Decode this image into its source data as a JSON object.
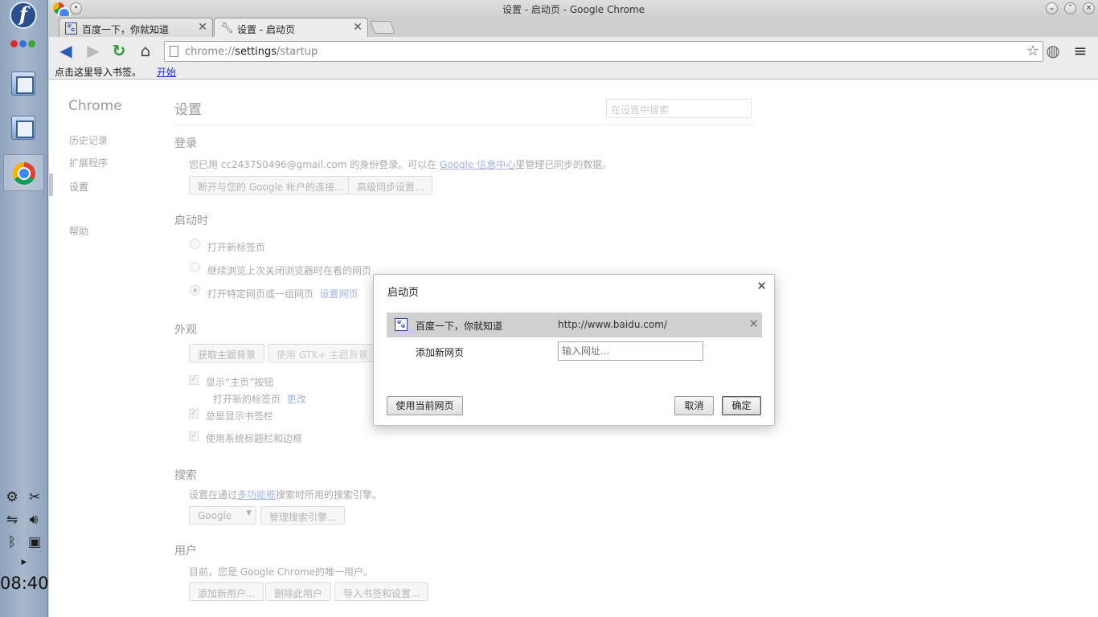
{
  "desktop": {
    "clock": "08:40",
    "fedora_letter": "f"
  },
  "window": {
    "title": "设置 - 启动页 - Google Chrome",
    "tabs": [
      {
        "title": "百度一下，你就知道",
        "icon": "baidu-paw-icon"
      },
      {
        "title": "设置 - 启动页",
        "icon": "wrench-icon"
      }
    ],
    "omnibox": {
      "scheme": "chrome://",
      "host": "settings",
      "path": "/startup"
    },
    "bookmark_bar": {
      "prompt": "点击这里导入书签。",
      "link": "开始"
    }
  },
  "sidebar": {
    "title": "Chrome",
    "items": [
      "历史记录",
      "扩展程序",
      "设置",
      "帮助"
    ]
  },
  "settings": {
    "title": "设置",
    "search_placeholder": "在设置中搜索",
    "login": {
      "heading": "登录",
      "text_pre": "您已用 cc243750496@gmail.com 的身份登录。可以在 ",
      "text_link": "Google 信息中心",
      "text_post": "里管理已同步的数据。",
      "disconnect_button": "断开与您的 Google 帐户的连接...",
      "advanced_sync_button": "高级同步设置..."
    },
    "startup": {
      "heading": "启动时",
      "option_newtab": "打开新标签页",
      "option_continue": "继续浏览上次关闭浏览器时在看的网页",
      "option_specific": "打开特定网页或一组网页",
      "set_pages_link": "设置网页"
    },
    "appearance": {
      "heading": "外观",
      "get_themes_button": "获取主题背景",
      "gtk_theme_button": "使用 GTK+ 主题背景",
      "show_home_label": "显示“主页”按钮",
      "home_sub_text": "打开新的标签页",
      "home_change_link": "更改",
      "bookmarks_bar_label": "总是显示书签栏",
      "system_titlebar_label": "使用系统标题栏和边框"
    },
    "search": {
      "heading": "搜索",
      "text_pre": "设置在通过",
      "text_link": "多功能框",
      "text_post": "搜索时所用的搜索引擎。",
      "engine_value": "Google",
      "manage_button": "管理搜索引擎..."
    },
    "users": {
      "heading": "用户",
      "text": "目前，您是 Google Chrome的唯一用户。",
      "add_user_button": "添加新用户...",
      "delete_user_button": "删除此用户",
      "import_button": "导入书签和设置..."
    }
  },
  "dialog": {
    "title": "启动页",
    "pages": [
      {
        "name": "百度一下，你就知道",
        "url": "http://www.baidu.com/"
      }
    ],
    "add_label": "添加新网页",
    "url_placeholder": "输入网址...",
    "use_current_button": "使用当前网页",
    "cancel_button": "取消",
    "ok_button": "确定"
  }
}
